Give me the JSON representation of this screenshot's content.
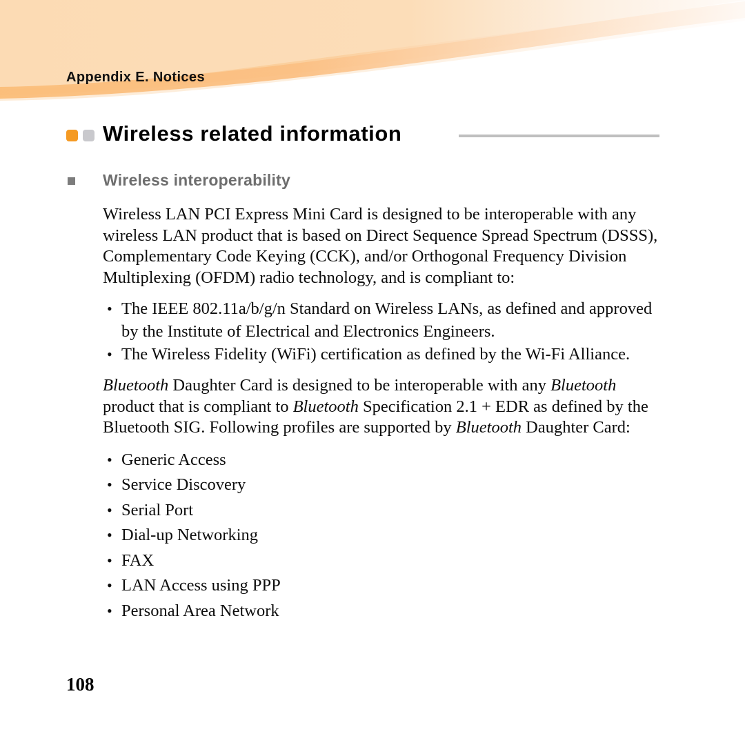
{
  "header": {
    "appendix_label": "Appendix E. Notices",
    "banner_base_color": "#FCDBB4",
    "banner_band_color": "#FBBE7A",
    "banner_light_band_color": "#FDEAD2"
  },
  "section": {
    "title": "Wireless related information",
    "marker_orange_color": "#F59A23",
    "marker_gray_color": "#C9C9CD",
    "rule_color": "#BFBFBF"
  },
  "subsection": {
    "title": "Wireless interoperability",
    "bullet_color": "#7C7C7C",
    "text_color": "#6E6E6E"
  },
  "body": {
    "intro_paragraph": "Wireless LAN PCI Express Mini Card is designed to be interoperable with any wireless LAN product that is based on Direct Sequence Spread Spectrum (DSSS), Complementary Code Keying (CCK), and/or Orthogonal Frequency Division Multiplexing (OFDM) radio technology, and is compliant to:",
    "standards_list": [
      "The IEEE 802.11a/b/g/n Standard on Wireless LANs, as defined and approved by the Institute of Electrical and Electronics Engineers.",
      "The Wireless Fidelity (WiFi) certification as defined by the Wi-Fi Alliance."
    ],
    "bluetooth_paragraph": {
      "part1_italic": "Bluetooth",
      "part2": " Daughter Card is designed to be interoperable with any ",
      "part3_italic": "Bluetooth",
      "part4": " product that is compliant to ",
      "part5_italic": "Bluetooth",
      "part6": " Specification 2.1 + EDR as defined by the Bluetooth SIG. Following profiles are supported by ",
      "part7_italic": "Bluetooth",
      "part8": " Daughter Card:"
    },
    "profiles_list": [
      "Generic Access",
      "Service Discovery",
      "Serial Port",
      "Dial-up Networking",
      "FAX",
      "LAN Access using PPP",
      "Personal Area Network"
    ]
  },
  "footer": {
    "page_number": "108"
  }
}
